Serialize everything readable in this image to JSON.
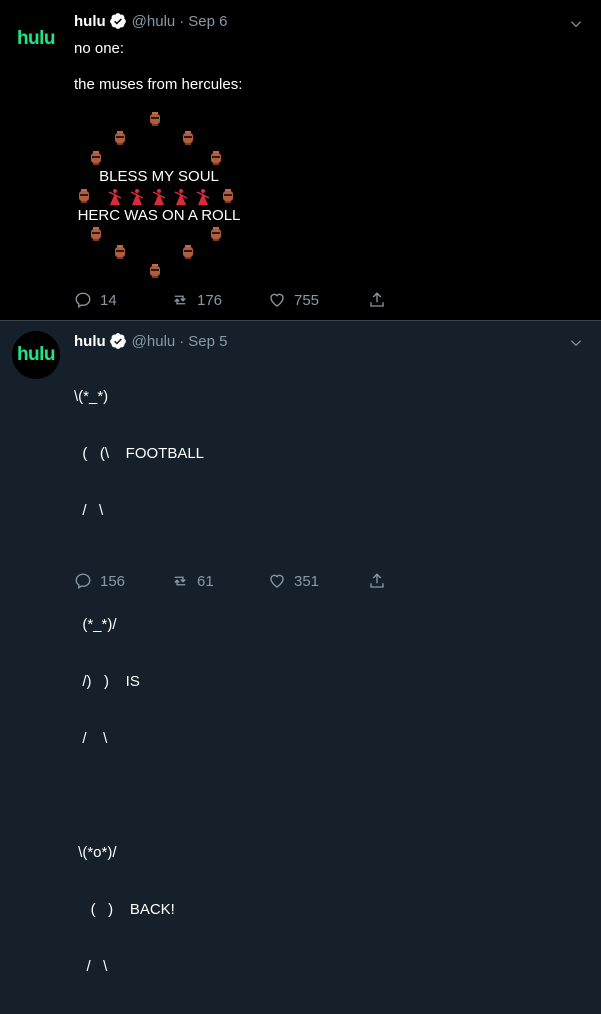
{
  "tweets": [
    {
      "avatar_text": "hulu",
      "name": "hulu",
      "handle": "@hulu",
      "separator": "·",
      "date": "Sep 6",
      "lines": [
        "no one:",
        "the muses from hercules:"
      ],
      "art": {
        "line1": "BLESS MY SOUL",
        "line2": "HERC WAS ON A ROLL"
      },
      "stats": {
        "replies": "14",
        "retweets": "176",
        "likes": "755"
      }
    },
    {
      "avatar_text": "hulu",
      "name": "hulu",
      "handle": "@hulu",
      "separator": "·",
      "date": "Sep 5",
      "lines": [
        "\\(*_*)",
        "  (   (\\    FOOTBALL",
        "  /   \\",
        "",
        "  (*_*)/",
        "  /)   )    IS",
        "  /    \\",
        "",
        " \\(*o*)/",
        "    (   )    BACK!",
        "   /   \\"
      ],
      "stats": {
        "replies": "156",
        "retweets": "61",
        "likes": "351"
      }
    }
  ],
  "colors": {
    "hulu_green": "#1ce783",
    "muted": "#8899a6",
    "verified": "#ffffff"
  },
  "icons": [
    "verified-badge-icon",
    "chevron-down-icon",
    "reply-icon",
    "retweet-icon",
    "like-icon",
    "share-icon",
    "urn-emoji-icon",
    "dancer-emoji-icon"
  ]
}
